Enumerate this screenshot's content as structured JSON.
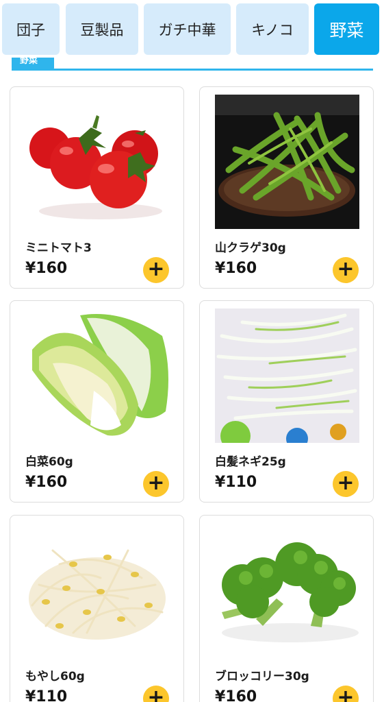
{
  "tabs": [
    {
      "label": "団子",
      "active": false
    },
    {
      "label": "豆製品",
      "active": false
    },
    {
      "label": "ガチ中華",
      "active": false
    },
    {
      "label": "キノコ",
      "active": false
    },
    {
      "label": "野菜",
      "active": true
    }
  ],
  "section": {
    "title": "野菜"
  },
  "products": [
    {
      "name": "ミニトマト3",
      "price": "¥160",
      "image": "cherry-tomatoes-image"
    },
    {
      "name": "山クラゲ30g",
      "price": "¥160",
      "image": "celtuce-strips-image"
    },
    {
      "name": "白菜60g",
      "price": "¥160",
      "image": "napa-cabbage-image"
    },
    {
      "name": "白髪ネギ25g",
      "price": "¥110",
      "image": "shredded-leek-image"
    },
    {
      "name": "もやし60g",
      "price": "¥110",
      "image": "bean-sprouts-image"
    },
    {
      "name": "ブロッコリー30g",
      "price": "¥160",
      "image": "broccoli-image"
    }
  ],
  "add_button": {
    "icon": "plus-icon"
  },
  "colors": {
    "tab_bg": "#d6ebfb",
    "tab_active_bg": "#0ba7ea",
    "accent_line": "#2fb5ec",
    "add_button": "#fcc62c"
  }
}
